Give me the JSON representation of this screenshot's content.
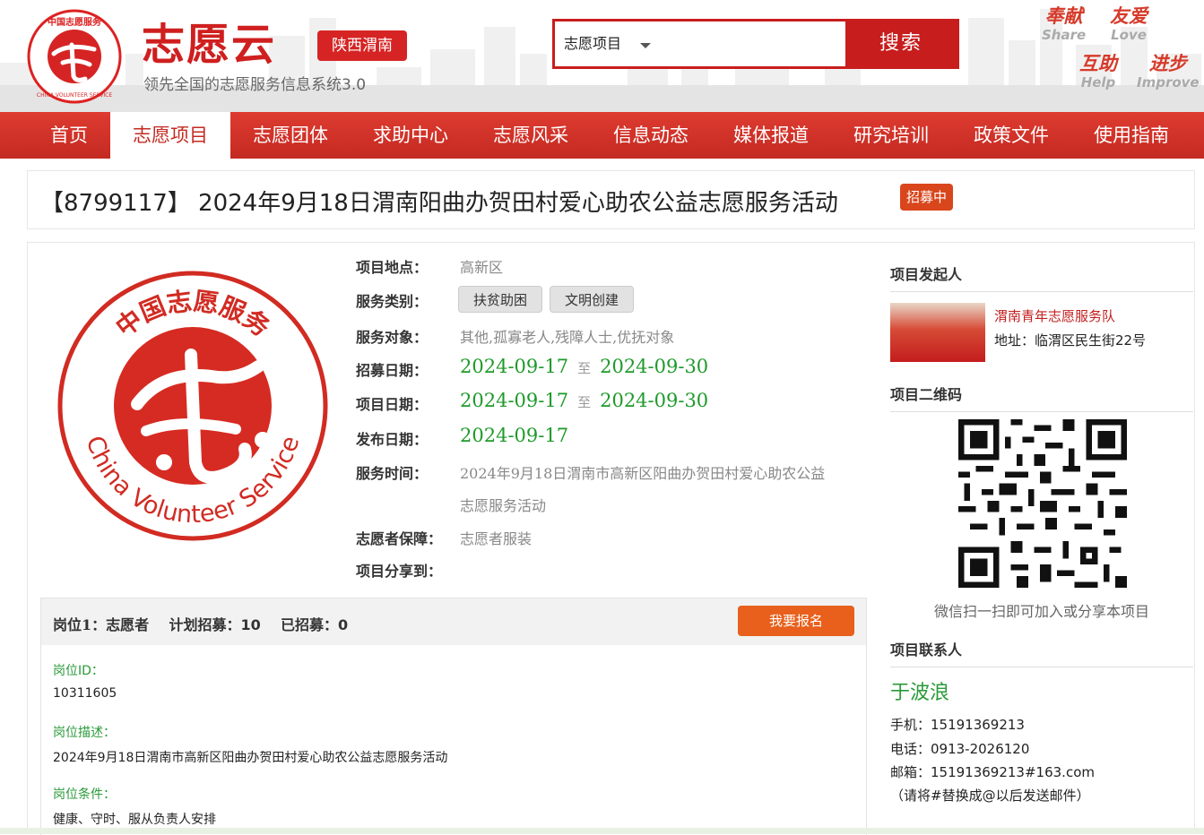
{
  "header": {
    "logo_title": "志愿云",
    "region": "陕西渭南",
    "tagline": "领先全国的志愿服务信息系统3.0",
    "search": {
      "category": "志愿项目",
      "placeholder": "",
      "button": "搜索"
    },
    "slogans": [
      {
        "cn": "奉献",
        "en": "Share"
      },
      {
        "cn": "友爱",
        "en": "Love"
      },
      {
        "cn": "互助",
        "en": "Help"
      },
      {
        "cn": "进步",
        "en": "Improve"
      }
    ]
  },
  "nav": {
    "items": [
      "首页",
      "志愿项目",
      "志愿团体",
      "求助中心",
      "志愿风采",
      "信息动态",
      "媒体报道",
      "研究培训",
      "政策文件",
      "使用指南"
    ],
    "active_index": 1
  },
  "project": {
    "title": "【8799117】 2024年9月18日渭南阳曲办贺田村爱心助农公益志愿服务活动",
    "status": "招募中",
    "location_label": "项目地点：",
    "location": "高新区",
    "category_label": "服务类别：",
    "categories": [
      "扶贫助困",
      "文明创建"
    ],
    "target_label": "服务对象：",
    "target": "其他,孤寡老人,残障人士,优抚对象",
    "recruit_label": "招募日期：",
    "recruit_start": "2024-09-17",
    "recruit_end": "2024-09-30",
    "project_label": "项目日期：",
    "project_start": "2024-09-17",
    "project_end": "2024-09-30",
    "publish_label": "发布日期：",
    "publish_date": "2024-09-17",
    "time_label": "服务时间：",
    "time_line1": "2024年9月18日渭南市高新区阳曲办贺田村爱心助农公益",
    "time_line2": "志愿服务活动",
    "guarantee_label": "志愿者保障：",
    "guarantee": "志愿者服装",
    "share_label": "项目分享到：",
    "to": "至"
  },
  "post": {
    "label": "岗位1：",
    "role": "志愿者",
    "plan_label": "计划招募：",
    "plan": "10",
    "done_label": "已招募：",
    "done": "0",
    "signup": "我要报名",
    "id_label": "岗位ID：",
    "id": "10311605",
    "desc_label": "岗位描述：",
    "desc": "2024年9月18日渭南市高新区阳曲办贺田村爱心助农公益志愿服务活动",
    "cond_label": "岗位条件：",
    "cond": "健康、守时、服从负责人安排"
  },
  "sidebar": {
    "initiator_head": "项目发起人",
    "team_name": "渭南青年志愿服务队",
    "team_address": "地址：临渭区民生街22号",
    "qr_head": "项目二维码",
    "qr_caption": "微信扫一扫即可加入或分享本项目",
    "contact_head": "项目联系人",
    "contact_name": "于波浪",
    "phone": "手机：15191369213",
    "tel": "电话：0913-2026120",
    "email": "邮箱：15191369213#163.com",
    "email_note": "（请将#替换成@以后发送邮件）"
  },
  "colors": {
    "brand_red": "#c81d1d",
    "nav_red": "#d4322a",
    "date_green": "#1e9a2a",
    "signup_orange": "#e8601c"
  }
}
